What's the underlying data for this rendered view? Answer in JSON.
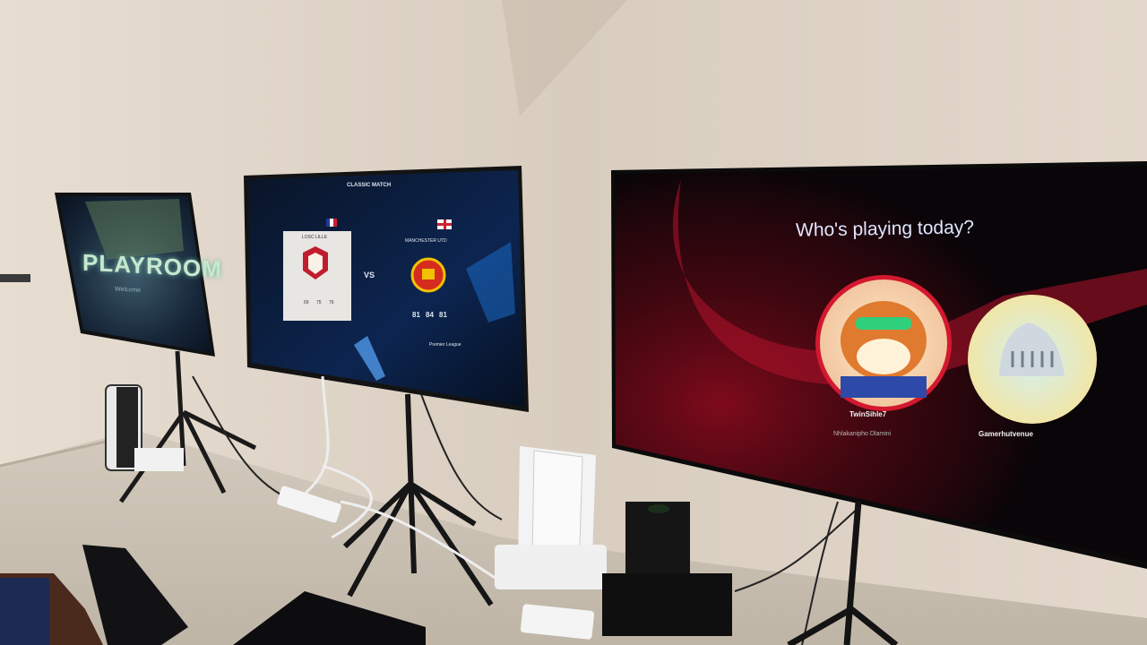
{
  "scene": {
    "screen_left": {
      "title": "PLAYROOM",
      "subtitle": "Welcome"
    },
    "screen_middle": {
      "header": "CLASSIC MATCH",
      "home_team": {
        "name": "LOSC LILLE",
        "stats": [
          "69",
          "75",
          "76"
        ]
      },
      "vs_label": "VS",
      "away_team": {
        "name": "MANCHESTER UTD",
        "stats": [
          "81",
          "84",
          "81"
        ],
        "league": "Premier League"
      }
    },
    "screen_right": {
      "title": "Who's playing today?",
      "profiles": [
        {
          "gamertag": "TwinSihle7",
          "real_name": "Nhlakanipho Dlamini"
        },
        {
          "gamertag": "Gamerhutvenue"
        }
      ]
    }
  },
  "colors": {
    "wall": "#d9cfc2",
    "floor": "#cfc6b8",
    "screen_bezel": "#141414",
    "accent_red": "#c4112b",
    "accent_green": "#6fd3a5"
  }
}
